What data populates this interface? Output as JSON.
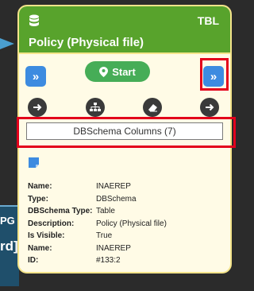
{
  "background": {
    "text1": "PG",
    "text2": "rd]"
  },
  "card": {
    "type_tag": "TBL",
    "title": "Policy (Physical file)",
    "start_label": "Start",
    "columns_label": "DBSchema Columns (7)",
    "colors": {
      "header": "#58a32c",
      "body": "#fffbe6",
      "border": "#f4e48a",
      "button_blue": "#3d8be0",
      "start_green": "#46ad57",
      "highlight_red": "#e3001b"
    },
    "action_icons": [
      "arrow-right-icon",
      "hierarchy-icon",
      "eraser-icon",
      "arrow-right-icon"
    ],
    "properties": [
      {
        "label": "Name:",
        "value": "INAEREP"
      },
      {
        "label": "Type:",
        "value": "DBSchema"
      },
      {
        "label": "DBSchema Type:",
        "value": "Table"
      },
      {
        "label": "Description:",
        "value": "Policy (Physical file)"
      },
      {
        "label": "Is Visible:",
        "value": "True"
      },
      {
        "label": "Name:",
        "value": "INAEREP"
      },
      {
        "label": "ID:",
        "value": "#133:2"
      }
    ]
  }
}
